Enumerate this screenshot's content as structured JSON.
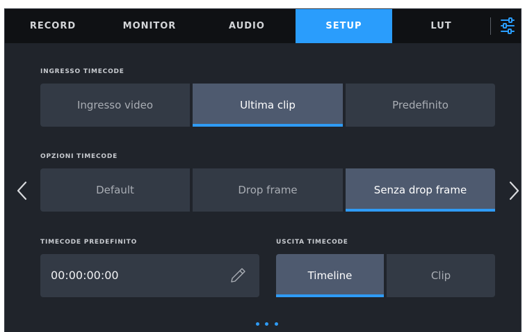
{
  "tabs": [
    {
      "label": "RECORD"
    },
    {
      "label": "MONITOR"
    },
    {
      "label": "AUDIO"
    },
    {
      "label": "SETUP"
    },
    {
      "label": "LUT"
    }
  ],
  "active_tab": "SETUP",
  "icons": {
    "settings": "sliders-icon",
    "prev": "chevron-left-icon",
    "next": "chevron-right-icon",
    "edit": "pencil-icon"
  },
  "colors": {
    "accent": "#2a9dfc",
    "background": "#20242b",
    "topbar": "#0f1114",
    "button": "#333a45",
    "button_selected": "#4e5a6f"
  },
  "timecode_input": {
    "label": "INGRESSO TIMECODE",
    "options": [
      "Ingresso video",
      "Ultima clip",
      "Predefinito"
    ],
    "selected": "Ultima clip"
  },
  "timecode_options": {
    "label": "OPZIONI TIMECODE",
    "options": [
      "Default",
      "Drop frame",
      "Senza drop frame"
    ],
    "selected": "Senza drop frame"
  },
  "preset_timecode": {
    "label": "TIMECODE PREDEFINITO",
    "value": "00:00:00:00"
  },
  "timecode_output": {
    "label": "USCITA TIMECODE",
    "options": [
      "Timeline",
      "Clip"
    ],
    "selected": "Timeline"
  },
  "pagination": {
    "pages": 3
  }
}
